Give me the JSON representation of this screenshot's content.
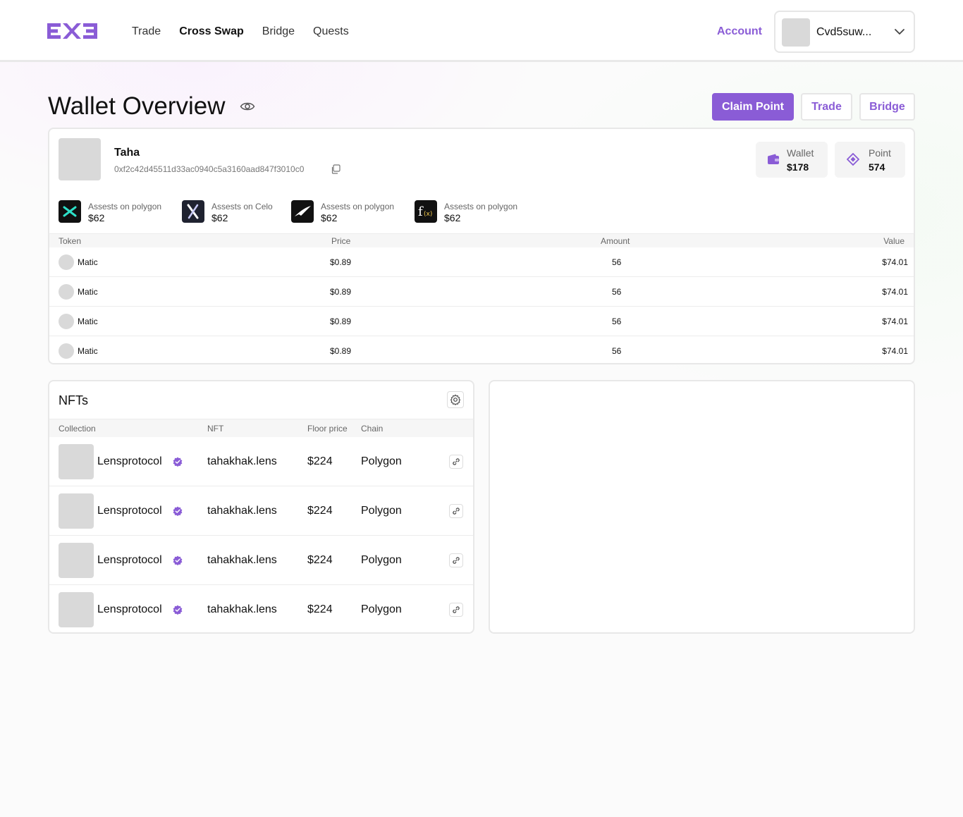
{
  "brand": {
    "logo_text": "EX3",
    "accent": "#8a5cd6"
  },
  "nav": [
    {
      "label": "Trade",
      "active": false
    },
    {
      "label": "Cross Swap",
      "active": true
    },
    {
      "label": "Bridge",
      "active": false
    },
    {
      "label": "Quests",
      "active": false
    }
  ],
  "header": {
    "account_label": "Account",
    "account_name": "Cvd5suw..."
  },
  "page": {
    "title": "Wallet Overview",
    "claim_label": "Claim Point",
    "trade_label": "Trade",
    "bridge_label": "Bridge"
  },
  "user": {
    "name": "Taha",
    "address": "0xf2c42d45511d33ac0940c5a3160aad847f3010c0"
  },
  "stats": {
    "wallet": {
      "label": "Wallet",
      "value": "$178"
    },
    "point": {
      "label": "Point",
      "value": "574"
    }
  },
  "chains": [
    {
      "label": "Assests on polygon",
      "value": "$62",
      "icon": "polygon-icon"
    },
    {
      "label": "Assests on Celo",
      "value": "$62",
      "icon": "celo-x-icon"
    },
    {
      "label": "Assests on polygon",
      "value": "$62",
      "icon": "bird-icon"
    },
    {
      "label": "Assests on polygon",
      "value": "$62",
      "icon": "fx-icon"
    }
  ],
  "tokens": {
    "headers": {
      "token": "Token",
      "price": "Price",
      "amount": "Amount",
      "value": "Value"
    },
    "rows": [
      {
        "token": "Matic",
        "price": "$0.89",
        "amount": "56",
        "value": "$74.01"
      },
      {
        "token": "Matic",
        "price": "$0.89",
        "amount": "56",
        "value": "$74.01"
      },
      {
        "token": "Matic",
        "price": "$0.89",
        "amount": "56",
        "value": "$74.01"
      },
      {
        "token": "Matic",
        "price": "$0.89",
        "amount": "56",
        "value": "$74.01"
      }
    ]
  },
  "nfts": {
    "title": "NFTs",
    "headers": {
      "collection": "Collection",
      "nft": "NFT",
      "floor": "Floor price",
      "chain": "Chain"
    },
    "rows": [
      {
        "collection": "Lensprotocol",
        "nft": "tahakhak.lens",
        "floor": "$224",
        "chain": "Polygon"
      },
      {
        "collection": "Lensprotocol",
        "nft": "tahakhak.lens",
        "floor": "$224",
        "chain": "Polygon"
      },
      {
        "collection": "Lensprotocol",
        "nft": "tahakhak.lens",
        "floor": "$224",
        "chain": "Polygon"
      },
      {
        "collection": "Lensprotocol",
        "nft": "tahakhak.lens",
        "floor": "$224",
        "chain": "Polygon"
      }
    ]
  }
}
